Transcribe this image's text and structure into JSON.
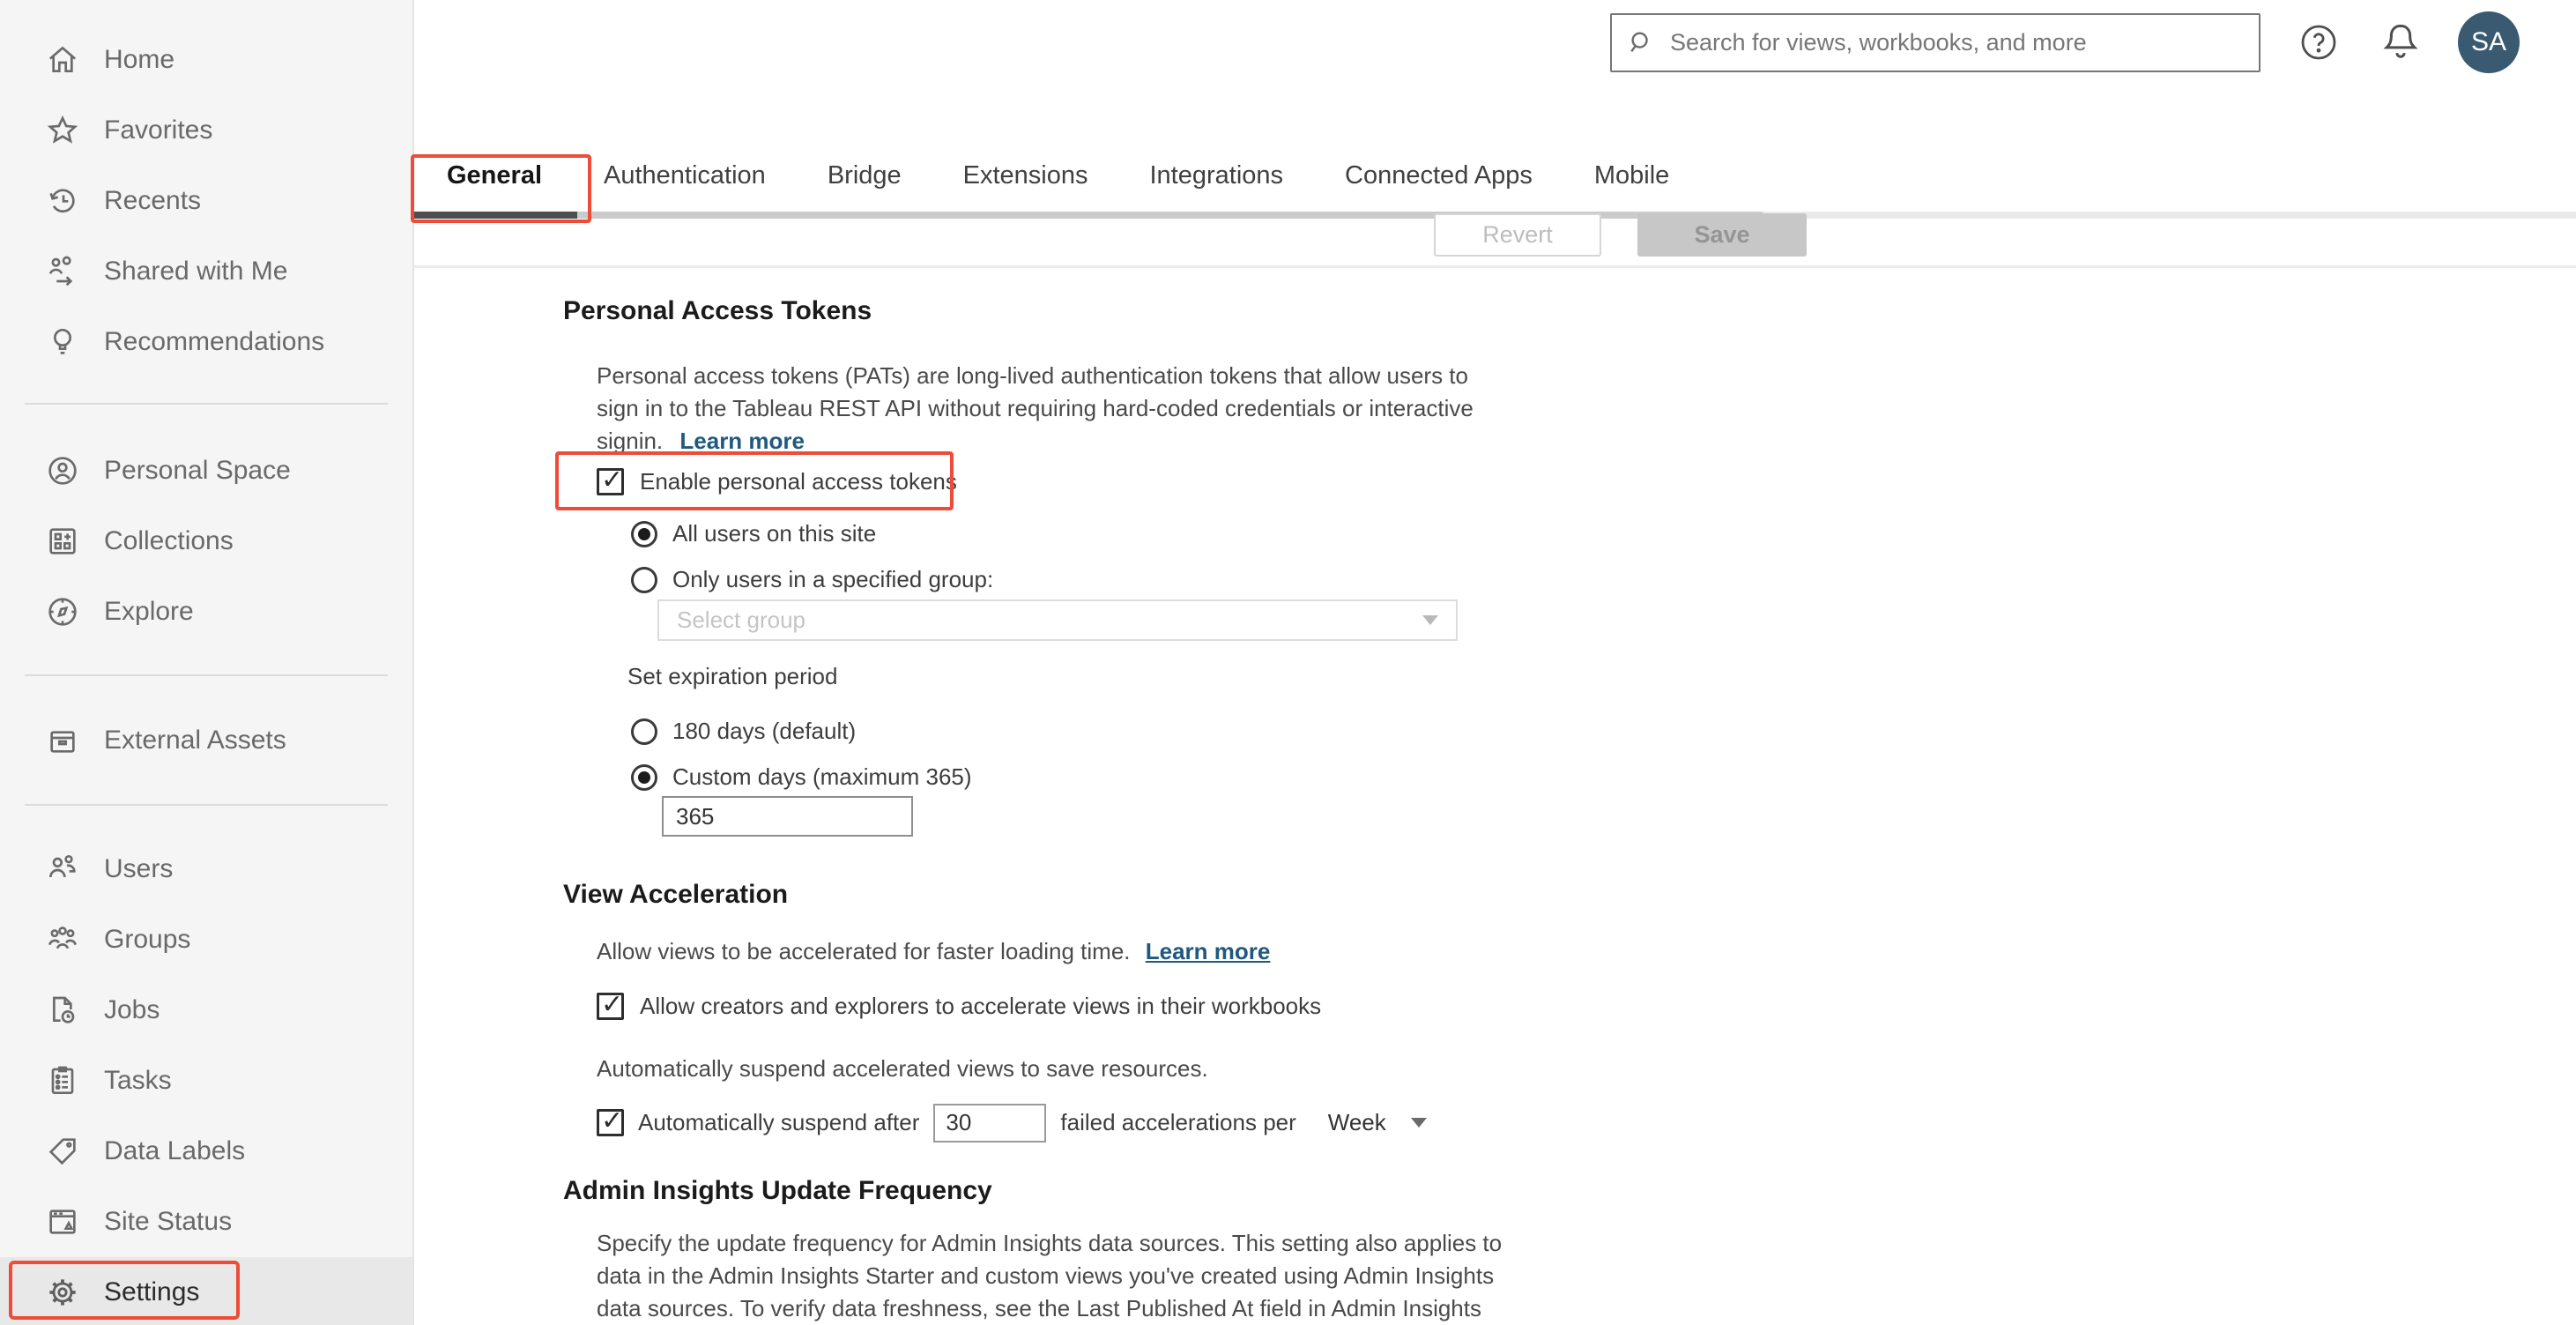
{
  "header": {
    "search_placeholder": "Search for views, workbooks, and more",
    "avatar_initials": "SA"
  },
  "sidebar": {
    "items": [
      {
        "label": "Home",
        "icon": "home-icon"
      },
      {
        "label": "Favorites",
        "icon": "star-icon"
      },
      {
        "label": "Recents",
        "icon": "recents-icon"
      },
      {
        "label": "Shared with Me",
        "icon": "shared-with-me-icon"
      },
      {
        "label": "Recommendations",
        "icon": "lightbulb-icon"
      },
      {
        "label": "Personal Space",
        "icon": "person-circle-icon"
      },
      {
        "label": "Collections",
        "icon": "collections-icon"
      },
      {
        "label": "Explore",
        "icon": "compass-icon"
      },
      {
        "label": "External Assets",
        "icon": "archive-icon"
      },
      {
        "label": "Users",
        "icon": "users-icon"
      },
      {
        "label": "Groups",
        "icon": "groups-icon"
      },
      {
        "label": "Jobs",
        "icon": "document-clock-icon"
      },
      {
        "label": "Tasks",
        "icon": "clipboard-icon"
      },
      {
        "label": "Data Labels",
        "icon": "tag-icon"
      },
      {
        "label": "Site Status",
        "icon": "window-status-icon"
      },
      {
        "label": "Settings",
        "icon": "gear-icon"
      }
    ],
    "selected": "Settings"
  },
  "tabs": {
    "items": [
      "General",
      "Authentication",
      "Bridge",
      "Extensions",
      "Integrations",
      "Connected Apps",
      "Mobile"
    ],
    "active": "General"
  },
  "toolbar": {
    "revert_label": "Revert",
    "save_label": "Save"
  },
  "sections": {
    "pat": {
      "title": "Personal Access Tokens",
      "description_lines": [
        "Personal access tokens (PATs) are long-lived authentication tokens that allow users to",
        "sign in to the Tableau REST API without requiring hard-coded credentials or interactive",
        "signin."
      ],
      "learn_more": "Learn more",
      "enable_label": "Enable personal access tokens",
      "enable_checked": true,
      "scope_options": [
        "All users on this site",
        "Only users in a specified group:"
      ],
      "scope_selected": "All users on this site",
      "group_placeholder": "Select group",
      "expiration_label": "Set expiration period",
      "expiration_options": [
        "180 days (default)",
        "Custom days (maximum 365)"
      ],
      "expiration_selected": "Custom days (maximum 365)",
      "custom_days_value": "365"
    },
    "view_acceleration": {
      "title": "View Acceleration",
      "description": "Allow views to be accelerated for faster loading time.",
      "learn_more": "Learn more",
      "allow_label": "Allow creators and explorers to accelerate views in their workbooks",
      "allow_checked": true,
      "suspend_intro": "Automatically suspend accelerated views to save resources.",
      "suspend_prefix": "Automatically suspend after",
      "suspend_value": "30",
      "suspend_suffix": "failed accelerations per",
      "suspend_period": "Week",
      "suspend_checked": true
    },
    "admin_insights": {
      "title": "Admin Insights Update Frequency",
      "description_lines": [
        "Specify the update frequency for Admin Insights data sources. This setting also applies to",
        "data in the Admin Insights Starter and custom views you've created using Admin Insights",
        "data sources. To verify data freshness, see the Last Published At field in Admin Insights"
      ]
    }
  },
  "colors": {
    "highlight_red": "#ee4c38",
    "link_blue": "#20597f",
    "avatar_bg": "#3a5a72",
    "sidebar_bg": "#f5f5f5",
    "active_tab_underline": "#4e4e4e"
  }
}
